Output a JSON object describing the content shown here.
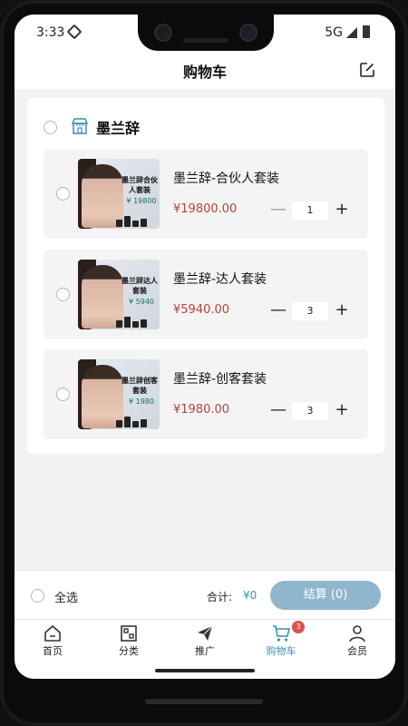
{
  "status_bar": {
    "time": "3:33",
    "network": "5G"
  },
  "header": {
    "title": "购物车"
  },
  "shop": {
    "name": "墨兰辞"
  },
  "items": [
    {
      "name": "墨兰辞-合伙人套装",
      "price": "¥19800.00",
      "quantity": "1",
      "thumb_title": "墨兰辞合伙人套装",
      "thumb_price": "¥ 19800"
    },
    {
      "name": "墨兰辞-达人套装",
      "price": "¥5940.00",
      "quantity": "3",
      "thumb_title": "墨兰辞达人套装",
      "thumb_price": "¥ 5940"
    },
    {
      "name": "墨兰辞-创客套装",
      "price": "¥1980.00",
      "quantity": "3",
      "thumb_title": "墨兰辞创客套装",
      "thumb_price": "¥ 1980"
    }
  ],
  "checkout": {
    "select_all_label": "全选",
    "total_label": "合计:",
    "total_value": "¥0",
    "button_label": "结算 (0)"
  },
  "tabs": [
    {
      "label": "首页",
      "icon": "home-icon"
    },
    {
      "label": "分类",
      "icon": "category-icon"
    },
    {
      "label": "推广",
      "icon": "paper-plane-icon"
    },
    {
      "label": "购物车",
      "icon": "cart-icon",
      "active": true,
      "badge": "3"
    },
    {
      "label": "会员",
      "icon": "user-icon"
    }
  ],
  "colors": {
    "accent": "#3a8fb4",
    "price": "#b8413d",
    "checkout_button": "#8fb6cc",
    "badge": "#d9534f"
  }
}
